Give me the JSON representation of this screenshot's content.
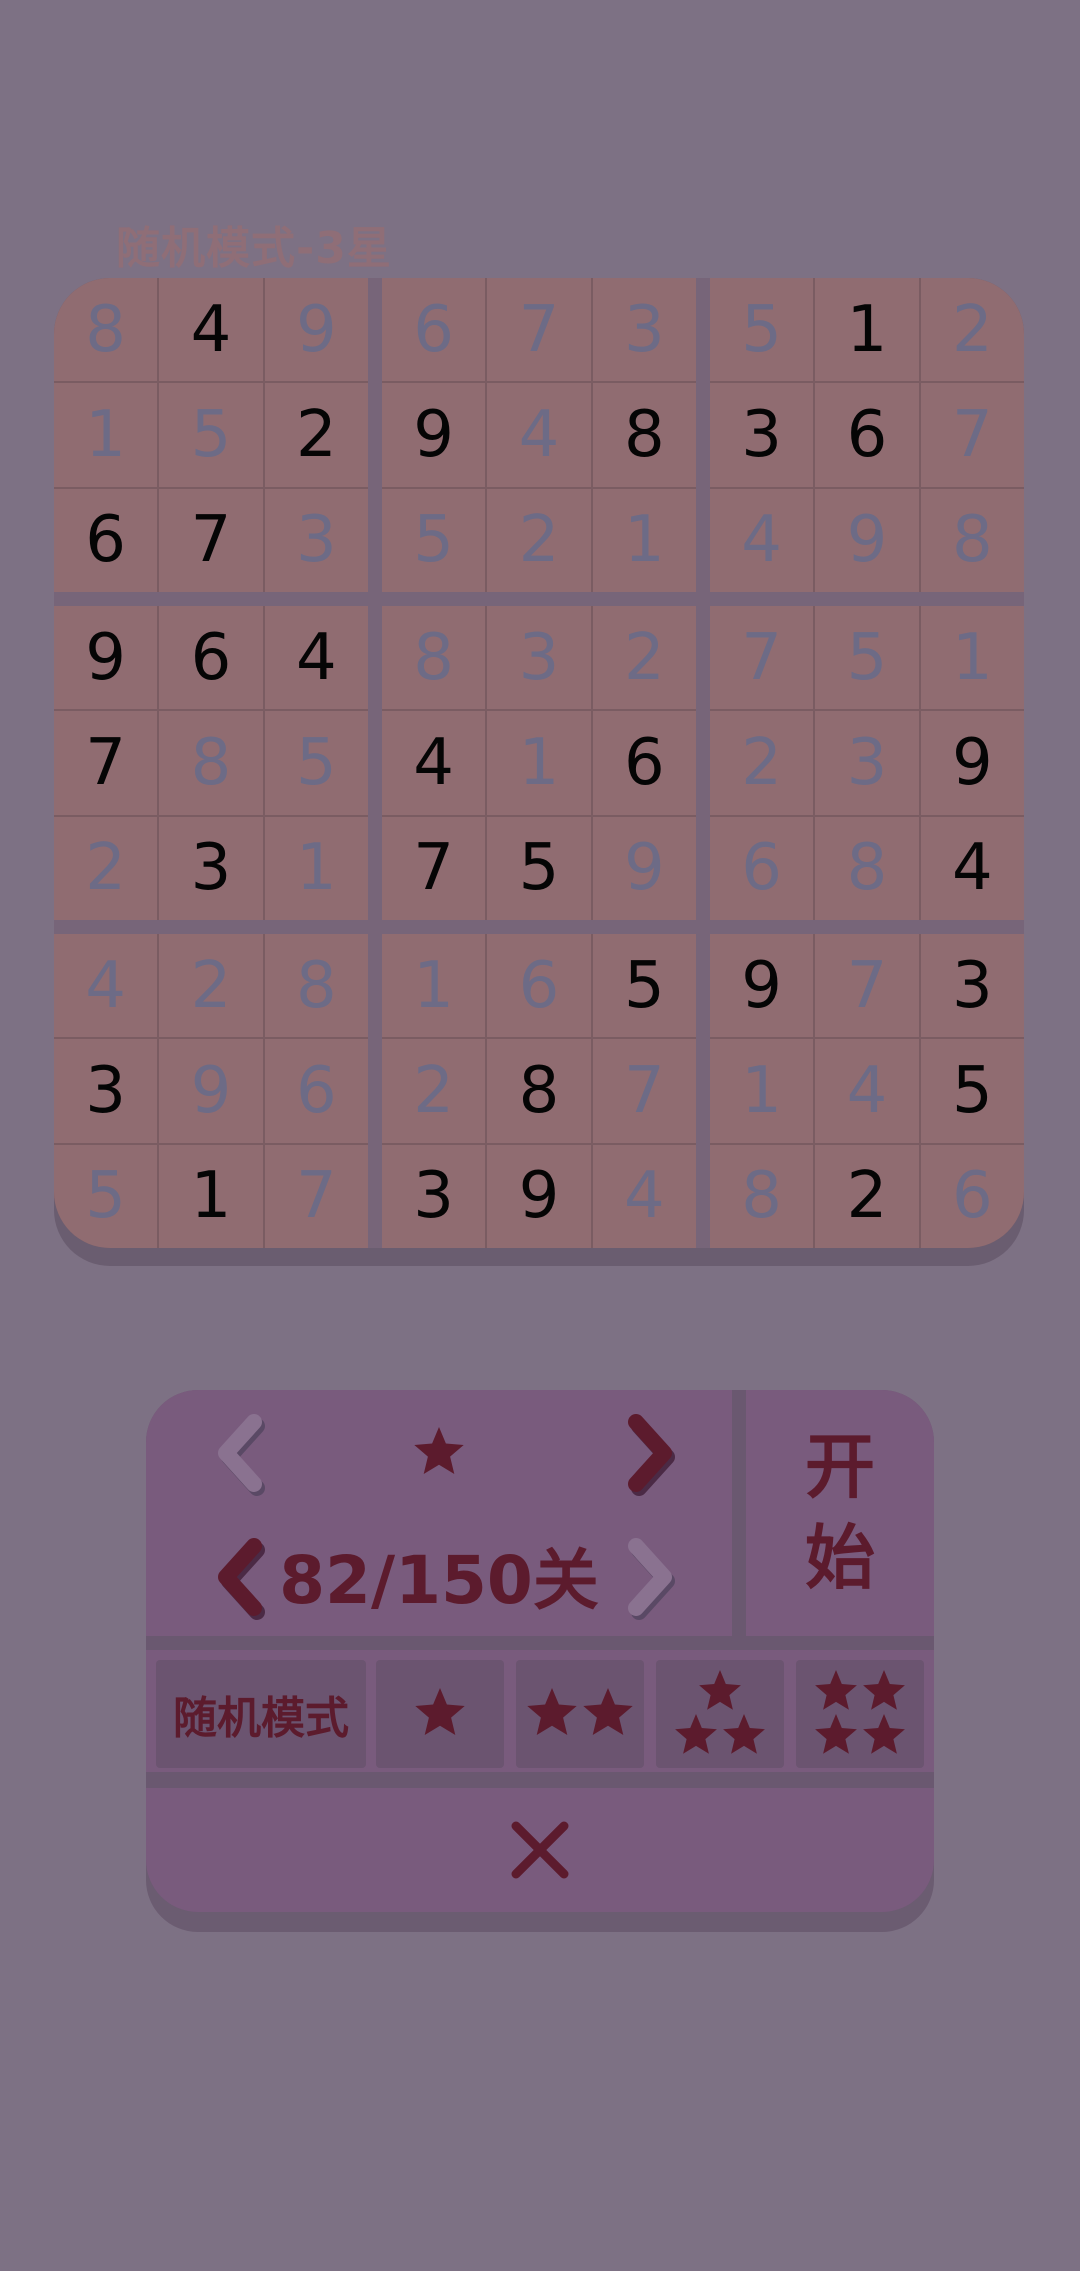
{
  "header": {
    "mode_title": "随机模式-3星"
  },
  "board": {
    "rows": [
      [
        "8",
        "4",
        "9",
        "6",
        "7",
        "3",
        "5",
        "1",
        "2"
      ],
      [
        "1",
        "5",
        "2",
        "9",
        "4",
        "8",
        "3",
        "6",
        "7"
      ],
      [
        "6",
        "7",
        "3",
        "5",
        "2",
        "1",
        "4",
        "9",
        "8"
      ],
      [
        "9",
        "6",
        "4",
        "8",
        "3",
        "2",
        "7",
        "5",
        "1"
      ],
      [
        "7",
        "8",
        "5",
        "4",
        "1",
        "6",
        "2",
        "3",
        "9"
      ],
      [
        "2",
        "3",
        "1",
        "7",
        "5",
        "9",
        "6",
        "8",
        "4"
      ],
      [
        "4",
        "2",
        "8",
        "1",
        "6",
        "5",
        "9",
        "7",
        "3"
      ],
      [
        "3",
        "9",
        "6",
        "2",
        "8",
        "7",
        "1",
        "4",
        "5"
      ],
      [
        "5",
        "1",
        "7",
        "3",
        "9",
        "4",
        "8",
        "2",
        "6"
      ]
    ],
    "given": [
      [
        0,
        1,
        0,
        0,
        0,
        0,
        0,
        1,
        0
      ],
      [
        0,
        0,
        1,
        1,
        0,
        1,
        1,
        1,
        0
      ],
      [
        1,
        1,
        0,
        0,
        0,
        0,
        0,
        0,
        0
      ],
      [
        1,
        1,
        1,
        0,
        0,
        0,
        0,
        0,
        0
      ],
      [
        1,
        0,
        0,
        1,
        0,
        1,
        0,
        0,
        1
      ],
      [
        0,
        1,
        0,
        1,
        1,
        0,
        0,
        0,
        1
      ],
      [
        0,
        0,
        0,
        0,
        0,
        1,
        1,
        0,
        1
      ],
      [
        1,
        0,
        0,
        0,
        1,
        0,
        0,
        0,
        1
      ],
      [
        0,
        1,
        0,
        1,
        1,
        0,
        0,
        1,
        0
      ]
    ],
    "colors": {
      "given": "#050505",
      "filled": "#6d6b86"
    }
  },
  "panel": {
    "difficulty_stars": 1,
    "level_label": "82/150关",
    "start_label_1": "开",
    "start_label_2": "始",
    "modes": [
      {
        "label": "随机模式",
        "stars": 0
      },
      {
        "label": "",
        "stars": 1
      },
      {
        "label": "",
        "stars": 2
      },
      {
        "label": "",
        "stars": 3
      },
      {
        "label": "",
        "stars": 4
      }
    ],
    "icons": {
      "prev_difficulty": "chevron-left-icon",
      "next_difficulty": "chevron-right-icon",
      "prev_level": "chevron-left-icon",
      "next_level": "chevron-right-icon",
      "close": "close-icon"
    },
    "accent_color": "#5c1b2d"
  }
}
